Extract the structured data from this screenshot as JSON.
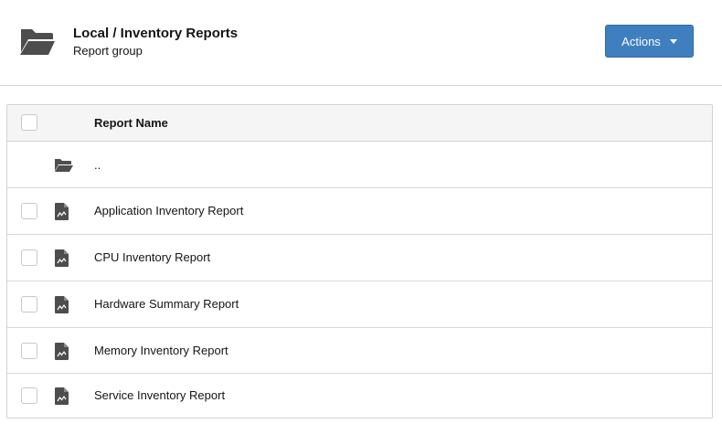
{
  "header": {
    "title": "Local / Inventory Reports",
    "subtitle": "Report group",
    "icon": "folder-open-icon",
    "actions_label": "Actions"
  },
  "table": {
    "columns": [
      "Report Name"
    ],
    "parent_row": {
      "name": "..",
      "icon": "folder-open-icon"
    },
    "rows": [
      {
        "name": "Application Inventory Report",
        "icon": "report-document-icon",
        "checked": false
      },
      {
        "name": "CPU Inventory Report",
        "icon": "report-document-icon",
        "checked": false
      },
      {
        "name": "Hardware Summary Report",
        "icon": "report-document-icon",
        "checked": false
      },
      {
        "name": "Memory Inventory Report",
        "icon": "report-document-icon",
        "checked": false
      },
      {
        "name": "Service Inventory Report",
        "icon": "report-document-icon",
        "checked": false
      }
    ]
  },
  "colors": {
    "accent": "#3f7fbf",
    "icon": "#4d4d4d",
    "border": "#d2d2d2",
    "header_bg": "#f5f5f5"
  }
}
